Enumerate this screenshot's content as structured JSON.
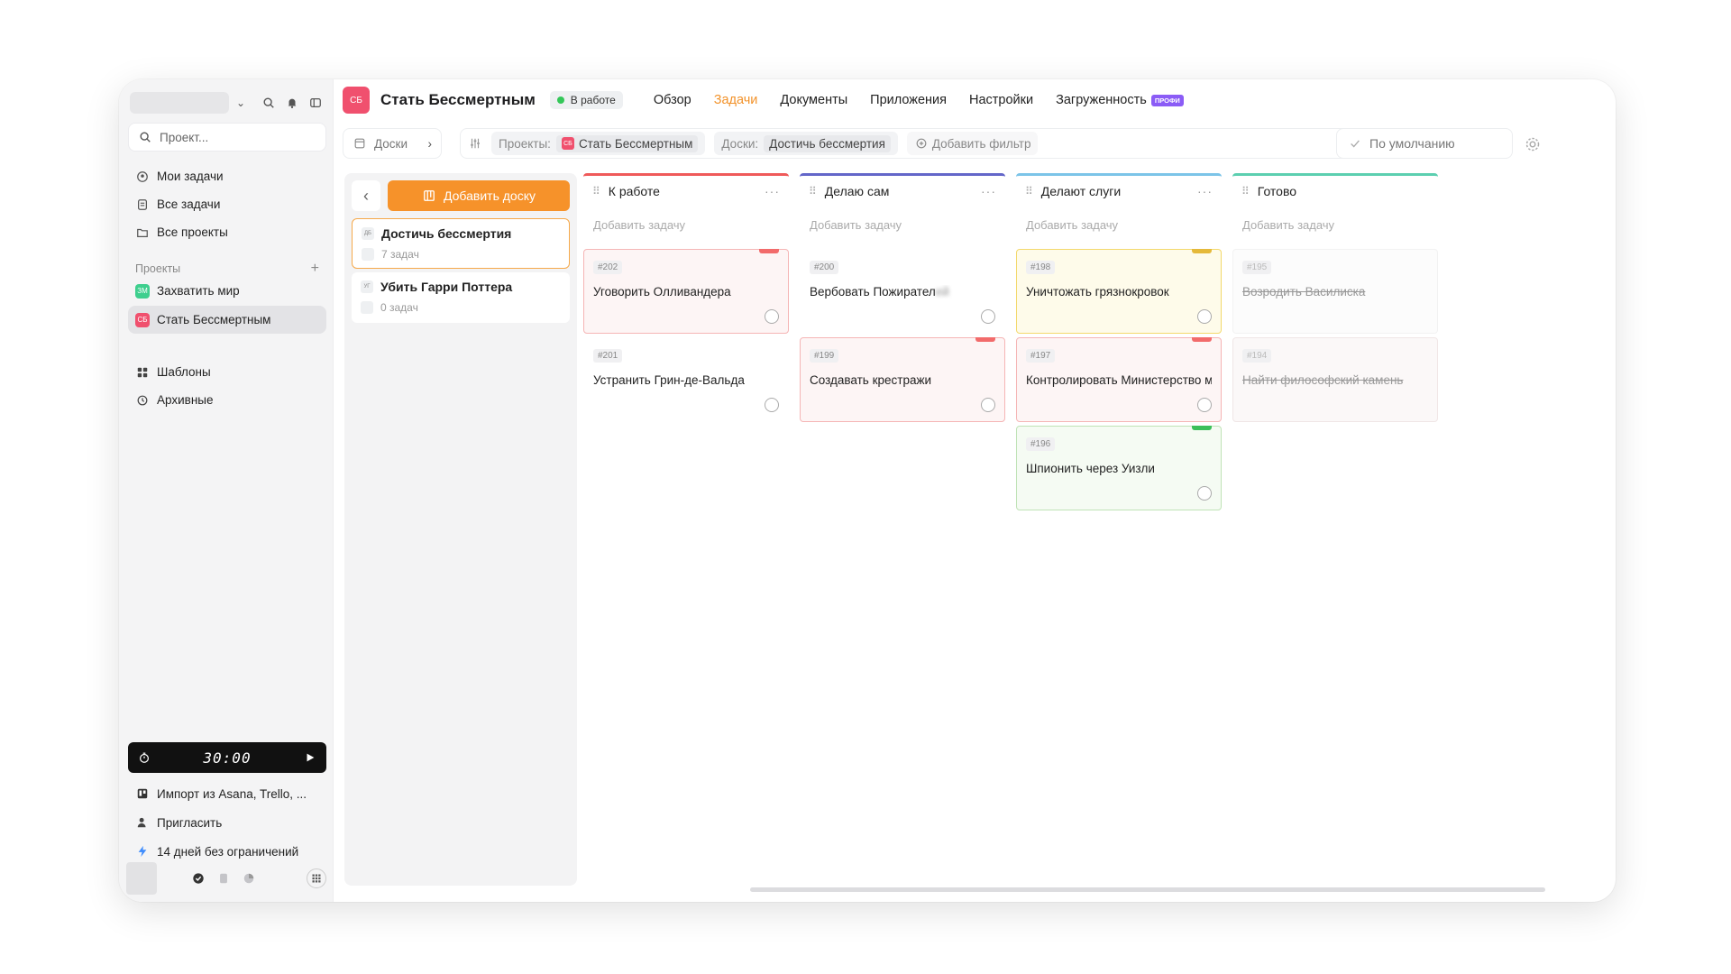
{
  "sidebar": {
    "search_placeholder": "Проект...",
    "nav": [
      "Мои задачи",
      "Все задачи",
      "Все проекты"
    ],
    "projects_heading": "Проекты",
    "projects": [
      {
        "badge": "ЗМ",
        "label": "Захватить мир",
        "color": "#3ecf8e"
      },
      {
        "badge": "СБ",
        "label": "Стать Бессмертным",
        "color": "#f0506e"
      }
    ],
    "extra": [
      "Шаблоны",
      "Архивные"
    ],
    "timer": "30:00",
    "bottom": [
      "Импорт из Asana, Trello, ...",
      "Пригласить",
      "14 дней без ограничений"
    ]
  },
  "header": {
    "logo": "СБ",
    "title": "Стать Бессмертным",
    "status": "В работе",
    "tabs": [
      "Обзор",
      "Задачи",
      "Документы",
      "Приложения",
      "Настройки",
      "Загруженность"
    ],
    "pro_badge": "ПРОФИ"
  },
  "toolbar": {
    "boards_label": "Доски",
    "filter_projects_label": "Проекты:",
    "filter_projects_badge": "СБ",
    "filter_projects_value": "Стать Бессмертным",
    "filter_boards_label": "Доски:",
    "filter_boards_value": "Достичь бессмертия",
    "add_filter": "Добавить фильтр",
    "default_view": "По умолчанию"
  },
  "boards": {
    "add_button": "Добавить доску",
    "items": [
      {
        "tag": "ДБ",
        "title": "Достичь бессмертия",
        "count": "7 задач"
      },
      {
        "tag": "УГ",
        "title": "Убить Гарри Поттера",
        "count": "0 задач"
      }
    ]
  },
  "columns": [
    {
      "title": "К работе",
      "color": "#ef5a5a",
      "add": "Добавить задачу",
      "tasks": [
        {
          "id": "#202",
          "title": "Уговорить Олливандера",
          "style": "red",
          "prio": "#f26b6b"
        },
        {
          "id": "#201",
          "title": "Устранить Грин-де-Вальда",
          "style": "plain",
          "prio": ""
        }
      ]
    },
    {
      "title": "Делаю сам",
      "color": "#6366c9",
      "add": "Добавить задачу",
      "tasks": [
        {
          "id": "#200",
          "title": "Вербовать Пожирател",
          "style": "plain",
          "prio": ""
        },
        {
          "id": "#199",
          "title": "Создавать крестражи",
          "style": "red",
          "prio": "#f26b6b"
        }
      ]
    },
    {
      "title": "Делают слуги",
      "color": "#7cc4e8",
      "add": "Добавить задачу",
      "tasks": [
        {
          "id": "#198",
          "title": "Уничтожать грязнокровок",
          "style": "yellow",
          "prio": "#e5b93a"
        },
        {
          "id": "#197",
          "title": "Контролировать Министерство магии",
          "style": "red",
          "prio": "#f26b6b"
        },
        {
          "id": "#196",
          "title": "Шпионить через Уизли",
          "style": "green",
          "prio": "#3cbf5a"
        }
      ]
    },
    {
      "title": "Готово",
      "color": "#5ccfb0",
      "add": "Добавить задачу",
      "tasks": [
        {
          "id": "#195",
          "title": "Возродить Василиска",
          "style": "done",
          "prio": ""
        },
        {
          "id": "#194",
          "title": "Найти философский камень",
          "style": "done-faded",
          "prio": ""
        }
      ]
    }
  ]
}
